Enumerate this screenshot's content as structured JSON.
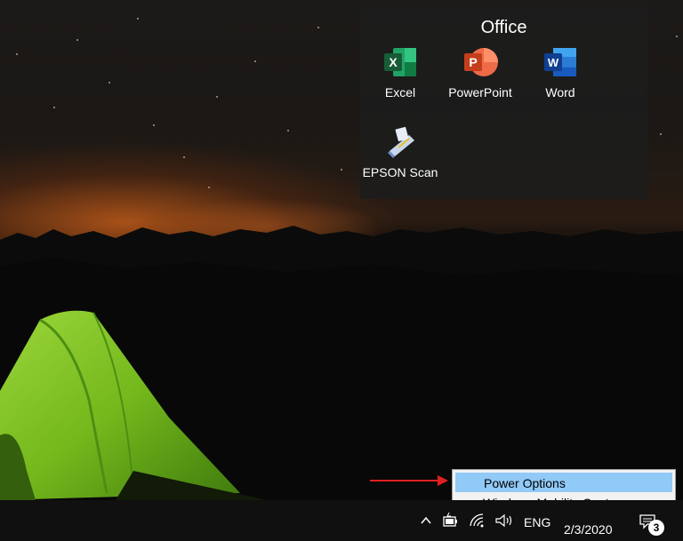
{
  "start_group": {
    "title": "Office",
    "tiles": [
      {
        "label": "Excel",
        "icon": "excel-icon",
        "color": "#1d7044"
      },
      {
        "label": "PowerPoint",
        "icon": "powerpoint-icon",
        "color": "#d24726"
      },
      {
        "label": "Word",
        "icon": "word-icon",
        "color": "#185abd"
      },
      {
        "label": "EPSON Scan",
        "icon": "scanner-icon",
        "color": "#6b8fc7"
      }
    ]
  },
  "context_menu": {
    "items": [
      {
        "label": "Power Options",
        "highlighted": true
      },
      {
        "label": "Windows Mobility Center",
        "highlighted": false
      }
    ],
    "highlight_color": "#91c9f7"
  },
  "annotation_arrow_color": "#e02020",
  "taskbar": {
    "tray": {
      "show_hidden_icon": "chevron-up-icon",
      "battery_icon": "battery-icon",
      "wifi_icon": "wifi-icon",
      "volume_icon": "volume-icon",
      "language": "ENG",
      "date": "2/3/2020",
      "notifications_icon": "notification-center-icon",
      "notification_count": "3"
    }
  }
}
